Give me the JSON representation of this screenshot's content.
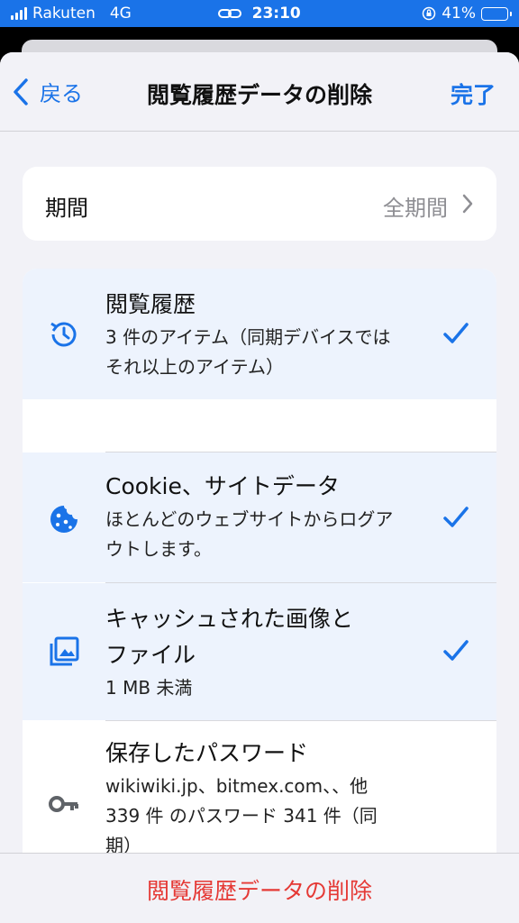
{
  "status_bar": {
    "carrier": "Rakuten",
    "network": "4G",
    "time": "23:10",
    "battery": "41%",
    "battery_level": 0.41
  },
  "nav": {
    "back_label": "戻る",
    "title": "閲覧履歴データの削除",
    "done_label": "完了"
  },
  "period": {
    "label": "期間",
    "value": "全期間"
  },
  "items": [
    {
      "title": "閲覧履歴",
      "subtitle_line1": "3 件のアイテム（同期デバイスでは",
      "subtitle_line2": "それ以上のアイテム）",
      "checked": true,
      "icon": "history-icon"
    },
    {
      "title": "Cookie、サイトデータ",
      "subtitle_line1": "ほとんどのウェブサイトからログア",
      "subtitle_line2": "ウトします。",
      "checked": true,
      "icon": "cookie-icon"
    },
    {
      "title_line1": "キャッシュされた画像と",
      "title_line2": "ファイル",
      "subtitle": "1 MB 未満",
      "checked": true,
      "icon": "image-icon"
    },
    {
      "title": "保存したパスワード",
      "subtitle_line1": "wikiwiki.jp、bitmex.com、、他",
      "subtitle_line2": "339 件 のパスワード 341 件（同",
      "subtitle_line3": "期）",
      "checked": false,
      "icon": "key-icon"
    }
  ],
  "bottom": {
    "delete_label": "閲覧履歴データの削除"
  },
  "colors": {
    "accent": "#1a73e8",
    "destructive": "#e53935",
    "selected_bg": "#edf3fd"
  }
}
